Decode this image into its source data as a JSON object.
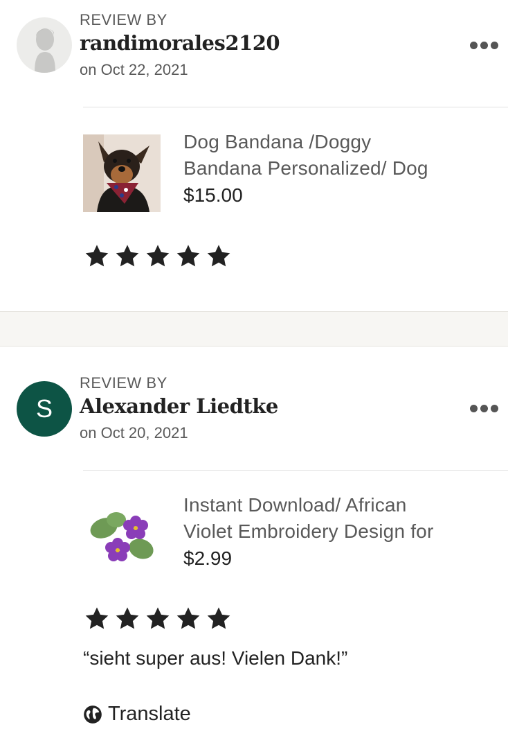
{
  "reviews": [
    {
      "review_by_label": "REVIEW BY",
      "reviewer": "randimorales2120",
      "date": "on Oct 22, 2021",
      "avatar_type": "silhouette-icon",
      "product": {
        "title_line1": "Dog Bandana /Doggy",
        "title_line2": "Bandana Personalized/ Dog",
        "price": "$15.00",
        "image": "dog-with-bandana-photo"
      },
      "rating": 5
    },
    {
      "review_by_label": "REVIEW BY",
      "reviewer": "Alexander Liedtke",
      "date": "on Oct 20, 2021",
      "avatar_initial": "S",
      "avatar_color": "#0d5445",
      "product": {
        "title_line1": "Instant Download/ African",
        "title_line2": "Violet Embroidery Design for",
        "price": "$2.99",
        "image": "african-violet-embroidery"
      },
      "rating": 5,
      "text": "“sieht super aus! Vielen Dank!”",
      "translate_label": "Translate"
    }
  ],
  "colors": {
    "star": "#222222",
    "muted_text": "#595959",
    "section_gap": "#f7f6f3"
  }
}
